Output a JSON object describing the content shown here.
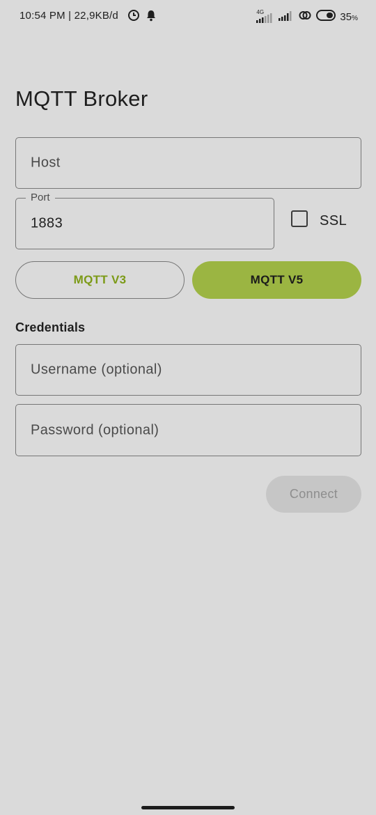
{
  "status_bar": {
    "time": "10:54 PM | 22,9KB/d",
    "network_label": "4G",
    "battery_value": "35",
    "battery_unit": "%"
  },
  "page": {
    "title": "MQTT Broker"
  },
  "form": {
    "host": {
      "placeholder": "Host"
    },
    "port": {
      "label": "Port",
      "value": "1883"
    },
    "ssl": {
      "label": "SSL",
      "checked": false
    },
    "versions": [
      {
        "label": "MQTT V3",
        "selected": false
      },
      {
        "label": "MQTT V5",
        "selected": true
      }
    ],
    "credentials_label": "Credentials",
    "username": {
      "placeholder": "Username (optional)"
    },
    "password": {
      "placeholder": "Password (optional)"
    },
    "connect_label": "Connect"
  },
  "colors": {
    "background": "#dadada",
    "accent": "#9bb542",
    "accent_text": "#7c9a17",
    "disabled_button": "#c6c6c6"
  }
}
